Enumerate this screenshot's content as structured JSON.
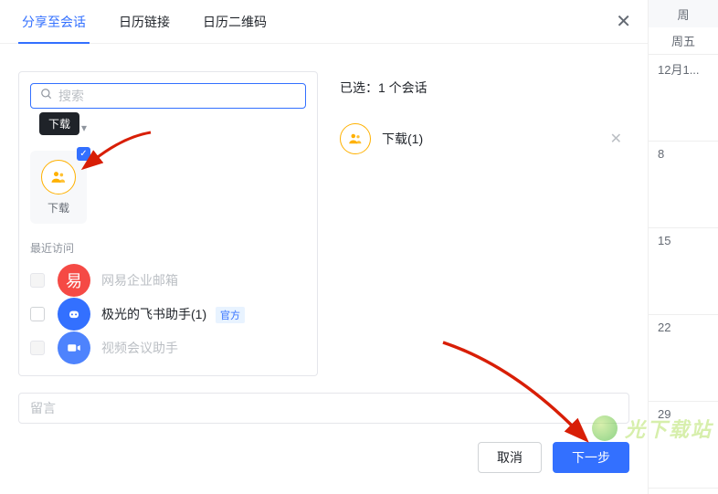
{
  "tabs": {
    "share": "分享至会话",
    "link": "日历链接",
    "qrcode": "日历二维码"
  },
  "search": {
    "placeholder": "搜索"
  },
  "tooltip": {
    "text": "下载"
  },
  "recent_card": {
    "label": "下载"
  },
  "sections": {
    "recent": "最近访问"
  },
  "items": {
    "netease": {
      "label": "网易企业邮箱"
    },
    "jiguang": {
      "label": "极光的飞书助手(1)",
      "badge": "官方"
    },
    "video": {
      "label": "视频会议助手"
    }
  },
  "selected": {
    "header_prefix": "已选：",
    "count_text": "1 个会话",
    "item_name": "下载(1)"
  },
  "message": {
    "placeholder": "留言"
  },
  "buttons": {
    "cancel": "取消",
    "next": "下一步"
  },
  "calendar": {
    "label_week": "周",
    "label_day": "周五",
    "cells": [
      "12月1...",
      "8",
      "15",
      "22",
      "29"
    ]
  },
  "watermark": {
    "text": "光下载站"
  },
  "colors": {
    "primary": "#3370ff",
    "orange": "#ffb100",
    "red_easy": "#f54a45",
    "blue_bot": "#3370ff",
    "blue_video": "#4e83fd"
  }
}
